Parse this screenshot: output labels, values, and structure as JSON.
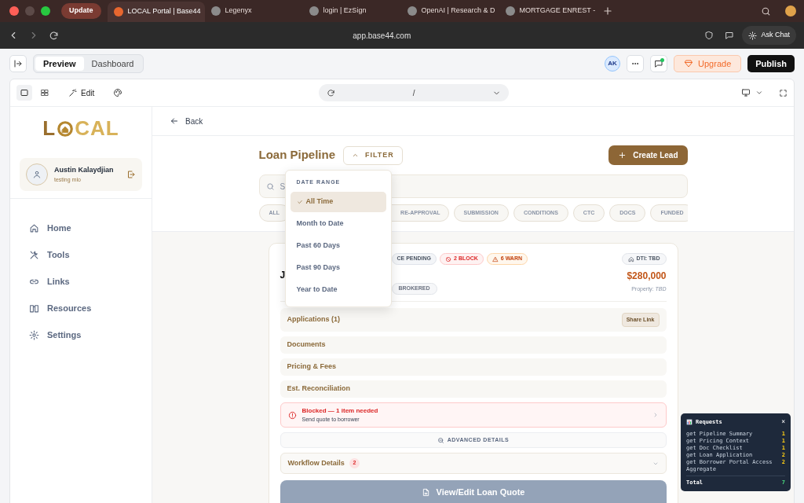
{
  "browser": {
    "update_button": "Update",
    "tabs": [
      {
        "title": "LOCAL Portal | Base44",
        "selected": true
      },
      {
        "title": "Legenyx",
        "selected": false
      },
      {
        "title": "login | EzSign",
        "selected": false
      },
      {
        "title": "OpenAI | Research & D",
        "selected": false
      },
      {
        "title": "MORTGAGE ENREST -",
        "selected": false
      }
    ],
    "address": "app.base44.com",
    "ask_chat": "Ask Chat"
  },
  "builder": {
    "view_tabs": [
      {
        "label": "Preview",
        "selected": true
      },
      {
        "label": "Dashboard",
        "selected": false
      }
    ],
    "avatar": "AK",
    "upgrade": "Upgrade",
    "publish": "Publish",
    "edit": "Edit",
    "path": "/"
  },
  "sidebar": {
    "logo_start": "L",
    "logo_end": "CAL",
    "user": {
      "name": "Austin Kalaydjian",
      "role": "testing mlo"
    },
    "nav": [
      {
        "label": "Home"
      },
      {
        "label": "Tools"
      },
      {
        "label": "Links"
      },
      {
        "label": "Resources"
      },
      {
        "label": "Settings"
      }
    ]
  },
  "main": {
    "back": "Back",
    "title": "Loan Pipeline",
    "filter": "FILTER",
    "create": "Create Lead",
    "search_placeholder": "S",
    "chips": [
      "ALL",
      "RE-APPROVAL",
      "SUBMISSION",
      "CONDITIONS",
      "CTC",
      "DOCS",
      "FUNDED"
    ],
    "dropdown": {
      "heading": "DATE RANGE",
      "options": [
        {
          "label": "All Time",
          "selected": true
        },
        {
          "label": "Month to Date",
          "selected": false
        },
        {
          "label": "Past 60 Days",
          "selected": false
        },
        {
          "label": "Past 90 Days",
          "selected": false
        },
        {
          "label": "Year to Date",
          "selected": false
        }
      ]
    },
    "card": {
      "badges": [
        {
          "kind": "status",
          "label": "CE PENDING"
        },
        {
          "kind": "block",
          "label": "2 BLOCK"
        },
        {
          "kind": "warn",
          "label": "6 WARN"
        }
      ],
      "dti": "DTI: TBD",
      "name": "J",
      "amount": "$280,000",
      "property": "Property: *TBD*",
      "tags": [
        "BROKERED"
      ],
      "sections": [
        {
          "title": "Applications (1)",
          "action": "Share Link"
        },
        {
          "title": "Documents"
        },
        {
          "title": "Pricing & Fees"
        },
        {
          "title": "Est. Reconciliation"
        }
      ],
      "alert": {
        "title": "Blocked — 1 item needed",
        "text": "Send quote to borrower"
      },
      "advanced": "ADVANCED DETAILS",
      "workflow": {
        "label": "Workflow Details",
        "count": "2"
      },
      "quote_button": "View/Edit Loan Quote"
    }
  },
  "requests": {
    "title": "Requests",
    "close": "×",
    "rows": [
      {
        "name": "get Pipeline Summary",
        "count": "1"
      },
      {
        "name": "get Pricing Context",
        "count": "1"
      },
      {
        "name": "get Doc Checklist",
        "count": "1"
      },
      {
        "name": "get Loan Application",
        "count": "2"
      },
      {
        "name": "get Borrower Portal Access Aggregate",
        "count": "2"
      }
    ],
    "total_label": "Total",
    "total": "7"
  }
}
